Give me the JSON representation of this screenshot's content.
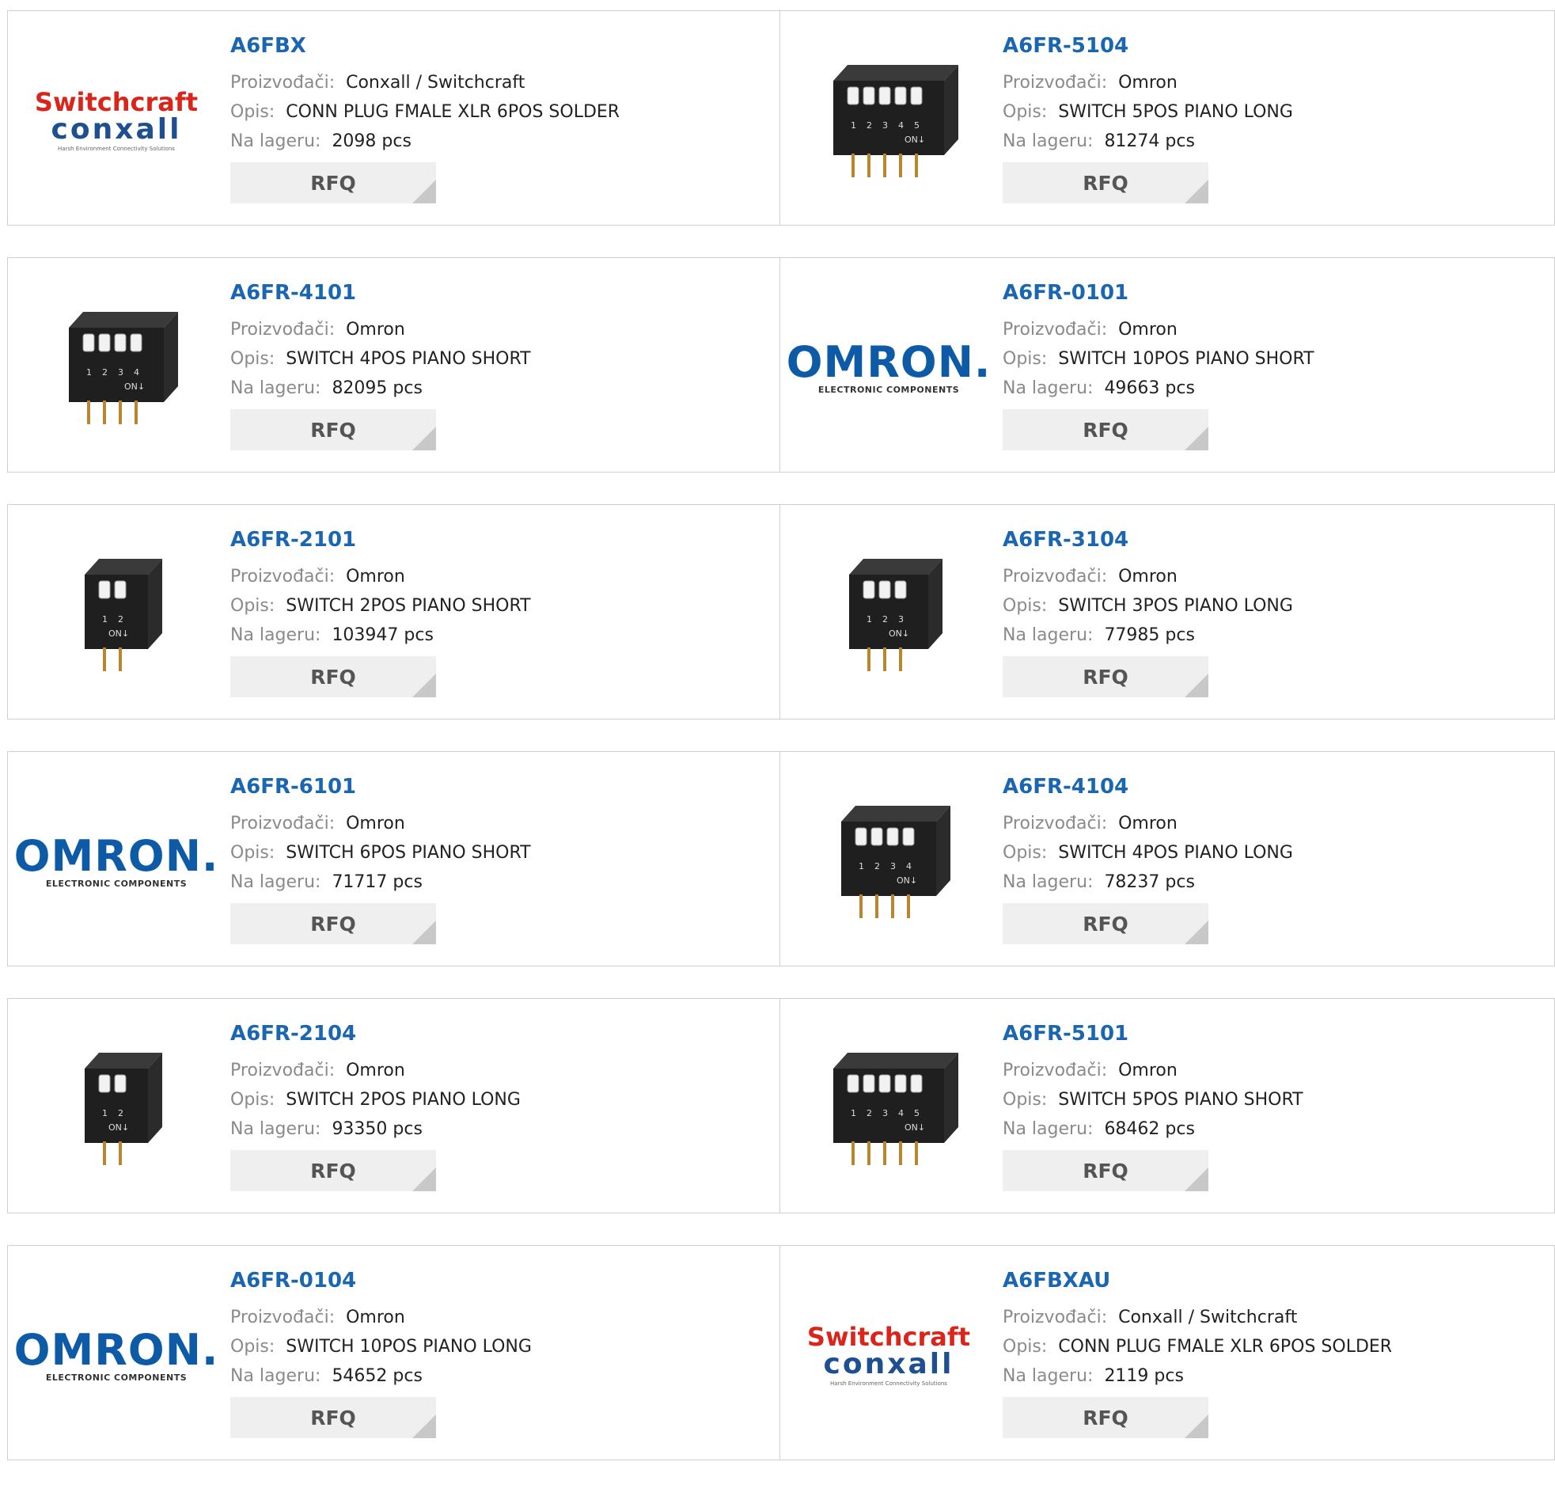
{
  "labels": {
    "manufacturer": "Proizvođači:",
    "description": "Opis:",
    "stock": "Na lageru:",
    "rfq": "RFQ"
  },
  "colors": {
    "part_number": "#1a66b0",
    "rfq_bg": "#efefef",
    "border": "#cfcfcf"
  },
  "logos": {
    "omron": {
      "word": "OMRON.",
      "sub": "ELECTRONIC COMPONENTS"
    },
    "switchcraft": {
      "top": "Switchcraft",
      "bottom": "conxall",
      "tag": "Harsh Environment Connectivity Solutions"
    }
  },
  "products": [
    {
      "pn": "A6FBX",
      "mfr": "Conxall / Switchcraft",
      "desc": "CONN PLUG FMALE XLR 6POS SOLDER",
      "stock": "2098 pcs",
      "image": "switchcraft-logo"
    },
    {
      "pn": "A6FR-5104",
      "mfr": "Omron",
      "desc": "SWITCH 5POS PIANO LONG",
      "stock": "81274 pcs",
      "image": "dip-switch-5"
    },
    {
      "pn": "A6FR-4101",
      "mfr": "Omron",
      "desc": "SWITCH 4POS PIANO SHORT",
      "stock": "82095 pcs",
      "image": "dip-switch-4"
    },
    {
      "pn": "A6FR-0101",
      "mfr": "Omron",
      "desc": "SWITCH 10POS PIANO SHORT",
      "stock": "49663 pcs",
      "image": "omron-logo"
    },
    {
      "pn": "A6FR-2101",
      "mfr": "Omron",
      "desc": "SWITCH 2POS PIANO SHORT",
      "stock": "103947 pcs",
      "image": "dip-switch-2"
    },
    {
      "pn": "A6FR-3104",
      "mfr": "Omron",
      "desc": "SWITCH 3POS PIANO LONG",
      "stock": "77985 pcs",
      "image": "dip-switch-3"
    },
    {
      "pn": "A6FR-6101",
      "mfr": "Omron",
      "desc": "SWITCH 6POS PIANO SHORT",
      "stock": "71717 pcs",
      "image": "omron-logo"
    },
    {
      "pn": "A6FR-4104",
      "mfr": "Omron",
      "desc": "SWITCH 4POS PIANO LONG",
      "stock": "78237 pcs",
      "image": "dip-switch-4"
    },
    {
      "pn": "A6FR-2104",
      "mfr": "Omron",
      "desc": "SWITCH 2POS PIANO LONG",
      "stock": "93350 pcs",
      "image": "dip-switch-2"
    },
    {
      "pn": "A6FR-5101",
      "mfr": "Omron",
      "desc": "SWITCH 5POS PIANO SHORT",
      "stock": "68462 pcs",
      "image": "dip-switch-5"
    },
    {
      "pn": "A6FR-0104",
      "mfr": "Omron",
      "desc": "SWITCH 10POS PIANO LONG",
      "stock": "54652 pcs",
      "image": "omron-logo"
    },
    {
      "pn": "A6FBXAU",
      "mfr": "Conxall / Switchcraft",
      "desc": "CONN PLUG FMALE XLR 6POS SOLDER",
      "stock": "2119 pcs",
      "image": "switchcraft-logo"
    }
  ]
}
